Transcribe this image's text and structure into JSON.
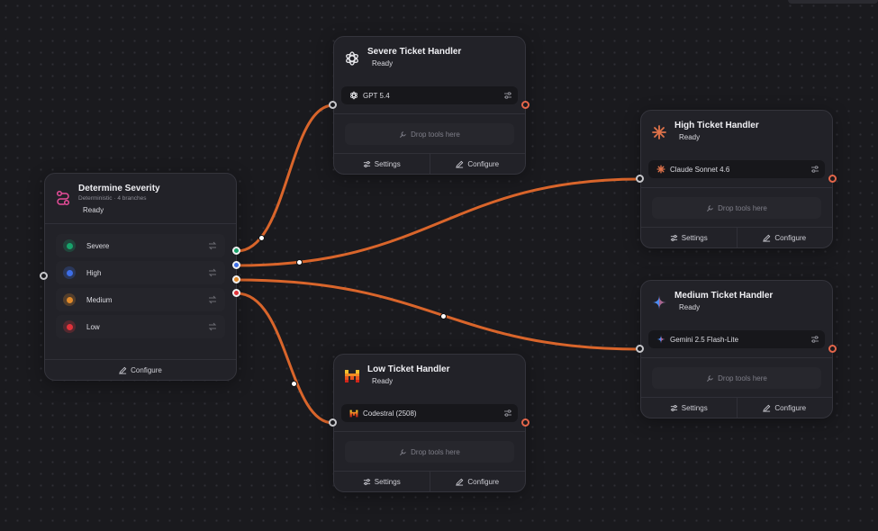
{
  "colors": {
    "edge": "#d9652b",
    "severe": "#18a36b",
    "high": "#3d6ee8",
    "medium": "#e08a2b",
    "low": "#e0323a"
  },
  "router": {
    "title": "Determine Severity",
    "subtitle": "Deterministic · 4 branches",
    "status": "Ready",
    "icon": "route-icon",
    "branches": [
      {
        "label": "Severe",
        "color": "#18a36b"
      },
      {
        "label": "High",
        "color": "#3d6ee8"
      },
      {
        "label": "Medium",
        "color": "#e08a2b"
      },
      {
        "label": "Low",
        "color": "#e0323a"
      }
    ],
    "configure_label": "Configure"
  },
  "handlers": {
    "severe": {
      "title": "Severe Ticket Handler",
      "status": "Ready",
      "model": "GPT 5.4",
      "icon": "openai-icon",
      "drop": "Drop tools here",
      "settings_label": "Settings",
      "configure_label": "Configure"
    },
    "high": {
      "title": "High Ticket Handler",
      "status": "Ready",
      "model": "Claude Sonnet 4.6",
      "icon": "anthropic-icon",
      "drop": "Drop tools here",
      "settings_label": "Settings",
      "configure_label": "Configure"
    },
    "medium": {
      "title": "Medium Ticket Handler",
      "status": "Ready",
      "model": "Gemini 2.5 Flash-Lite",
      "icon": "gemini-icon",
      "drop": "Drop tools here",
      "settings_label": "Settings",
      "configure_label": "Configure"
    },
    "low": {
      "title": "Low Ticket Handler",
      "status": "Ready",
      "model": "Codestral (2508)",
      "icon": "mistral-icon",
      "drop": "Drop tools here",
      "settings_label": "Settings",
      "configure_label": "Configure"
    }
  }
}
